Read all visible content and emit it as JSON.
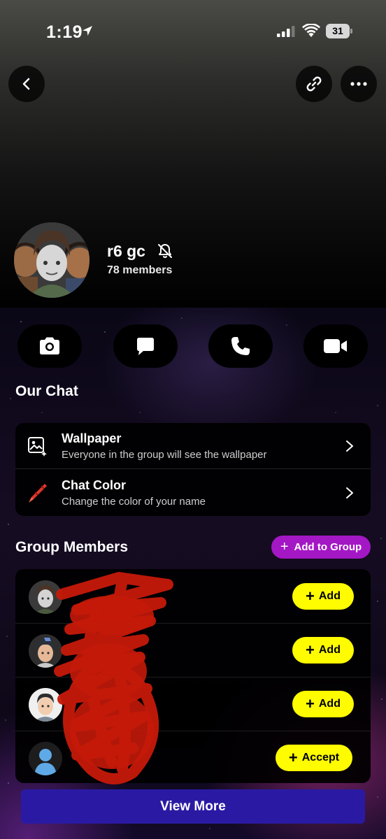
{
  "status_bar": {
    "time": "1:19",
    "battery": "31"
  },
  "group": {
    "name": "r6 gc",
    "members": "78 members"
  },
  "our_chat": {
    "title": "Our Chat",
    "items": [
      {
        "title": "Wallpaper",
        "subtitle": "Everyone in the group will see the wallpaper",
        "icon": "wallpaper-icon"
      },
      {
        "title": "Chat Color",
        "subtitle": "Change the color of your name",
        "icon": "crayon-icon"
      }
    ]
  },
  "group_members": {
    "title": "Group Members",
    "add_to_group": "Add to Group",
    "members": [
      {
        "action": "Add"
      },
      {
        "action": "Add"
      },
      {
        "action": "Add"
      },
      {
        "action": "Accept"
      }
    ],
    "view_more": "View More"
  },
  "colors": {
    "accent_yellow": "#fffc00",
    "add_to_group_purple": "#a318c4",
    "view_more_blue": "#2a1aa3"
  },
  "icons": [
    "back-icon",
    "link-icon",
    "more-icon",
    "camera-icon",
    "chat-icon",
    "phone-icon",
    "video-icon",
    "bell-muted-icon",
    "chevron-right-icon"
  ]
}
